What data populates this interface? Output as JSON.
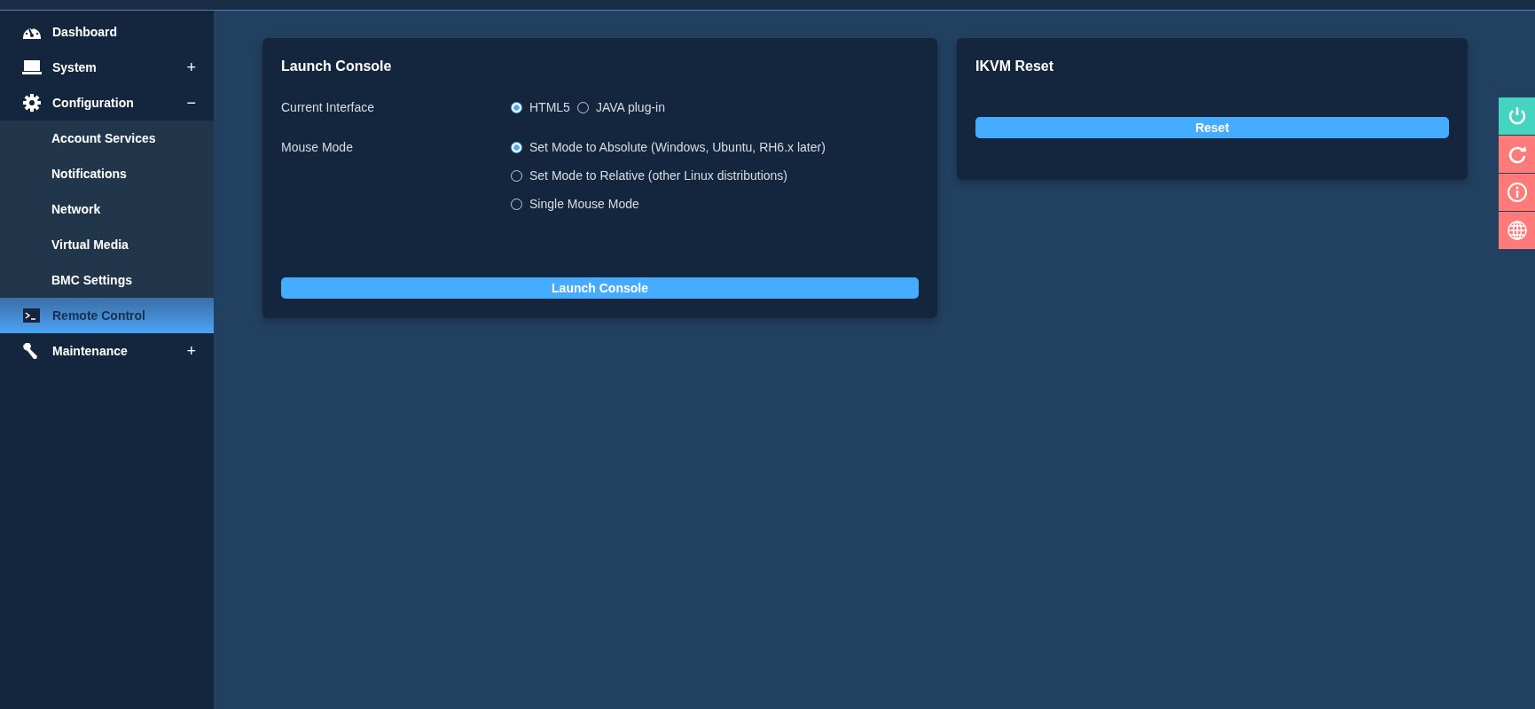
{
  "sidebar": {
    "items": [
      {
        "label": "Dashboard",
        "selected": false
      },
      {
        "label": "System",
        "selected": false,
        "toggle": "+"
      },
      {
        "label": "Configuration",
        "selected": false,
        "toggle": "−",
        "children": [
          {
            "label": "Account Services",
            "selected": false
          },
          {
            "label": "Notifications",
            "selected": false
          },
          {
            "label": "Network",
            "selected": false
          },
          {
            "label": "Virtual Media",
            "selected": false
          },
          {
            "label": "BMC Settings",
            "selected": false
          }
        ]
      },
      {
        "label": "Remote Control",
        "selected": true
      },
      {
        "label": "Maintenance",
        "selected": false,
        "toggle": "+"
      }
    ]
  },
  "launch_card": {
    "title": "Launch Console",
    "fields": [
      {
        "label": "Current Interface",
        "options": [
          {
            "label": "HTML5",
            "selected": true
          },
          {
            "label": "JAVA plug-in",
            "selected": false
          }
        ]
      },
      {
        "label": "Mouse Mode",
        "options": [
          {
            "label": "Set Mode to Absolute (Windows, Ubuntu, RH6.x later)",
            "selected": true
          },
          {
            "label": "Set Mode to Relative (other Linux distributions)",
            "selected": false
          },
          {
            "label": "Single Mouse Mode",
            "selected": false
          }
        ]
      }
    ],
    "button": "Launch Console"
  },
  "reset_card": {
    "title": "IKVM Reset",
    "button": "Reset"
  },
  "side_buttons": [
    {
      "kind": "power",
      "color": "#45d4bf"
    },
    {
      "kind": "refresh",
      "color": "#ff7a78"
    },
    {
      "kind": "info",
      "color": "#ff7a78"
    },
    {
      "kind": "globe",
      "color": "#ff7a78"
    }
  ]
}
